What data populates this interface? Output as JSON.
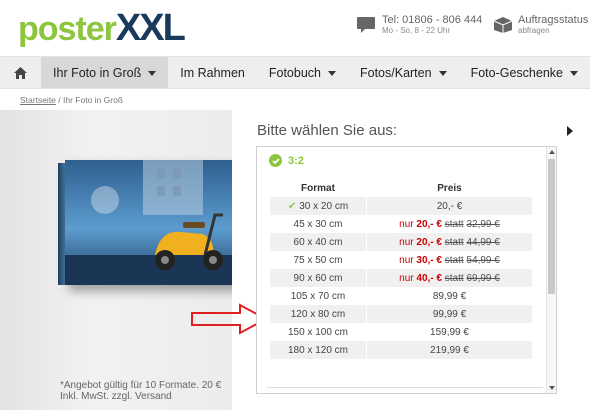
{
  "header": {
    "logo_part1": "poster",
    "logo_part2": "XXL",
    "phone": "Tel: 01806 - 806 444",
    "hours": "Mo - So, 8 - 22 Uhr",
    "order_status": "Auftragsstatus",
    "order_status_sub": "abfragen"
  },
  "nav": {
    "items": [
      {
        "label": "Ihr Foto in Groß",
        "dropdown": true,
        "active": true
      },
      {
        "label": "Im Rahmen",
        "dropdown": false
      },
      {
        "label": "Fotobuch",
        "dropdown": true
      },
      {
        "label": "Fotos/Karten",
        "dropdown": true
      },
      {
        "label": "Foto-Geschenke",
        "dropdown": true
      }
    ]
  },
  "breadcrumb": {
    "home": "Startseite",
    "separator": "/",
    "current": "Ihr Foto in Groß"
  },
  "note": {
    "line1": "*Angebot gültig für 10 Formate. 20 €",
    "line2": "Inkl. MwSt. zzgl. Versand"
  },
  "panel": {
    "title": "Bitte wählen Sie aus:",
    "group_label": "3:2",
    "col_format": "Format",
    "col_price": "Preis",
    "rows": [
      {
        "format": "30 x 20 cm",
        "selected": true,
        "price": "20,- €"
      },
      {
        "format": "45 x 30 cm",
        "nur": "nur",
        "sale": "20,- €",
        "statt": "statt",
        "old": "32,99 €"
      },
      {
        "format": "60 x 40 cm",
        "nur": "nur",
        "sale": "20,- €",
        "statt": "statt",
        "old": "44,99 €"
      },
      {
        "format": "75 x 50 cm",
        "nur": "nur",
        "sale": "30,- €",
        "statt": "statt",
        "old": "54,99 €"
      },
      {
        "format": "90 x 60 cm",
        "nur": "nur",
        "sale": "40,- €",
        "statt": "statt",
        "old": "69,99 €"
      },
      {
        "format": "105 x 70 cm",
        "price": "89,99 €"
      },
      {
        "format": "120 x 80 cm",
        "price": "99,99 €"
      },
      {
        "format": "150 x 100 cm",
        "price": "159,99 €"
      },
      {
        "format": "180 x 120 cm",
        "price": "219,99 €"
      }
    ]
  },
  "colors": {
    "brand_green": "#8cc63f",
    "brand_navy": "#1a3a5c",
    "sale_red": "#cc0000",
    "arrow_red": "#e02020"
  }
}
